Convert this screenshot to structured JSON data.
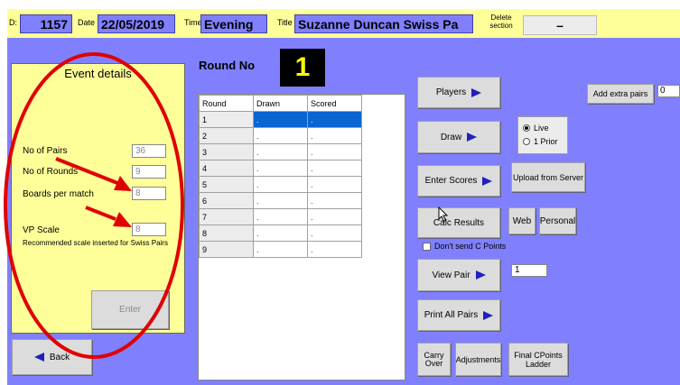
{
  "header": {
    "id_label": "D:",
    "id_value": "1157",
    "date_label": "Date",
    "date_value": "22/05/2019",
    "time_label": "Time",
    "time_value": "Evening",
    "title_label": "Title",
    "title_value": "Suzanne Duncan Swiss Pa",
    "delete_label_1": "Delete",
    "delete_label_2": "section",
    "delete_value": "–"
  },
  "event_details": {
    "heading": "Event details",
    "no_of_pairs_label": "No of Pairs",
    "no_of_pairs_value": "36",
    "no_of_rounds_label": "No of Rounds",
    "no_of_rounds_value": "9",
    "boards_per_match_label": "Boards per match",
    "boards_per_match_value": "8",
    "vp_scale_label": "VP Scale",
    "vp_scale_value": "8",
    "recommended_text": "Recommended scale inserted for Swiss Pairs",
    "enter_label": "Enter"
  },
  "round": {
    "label": "Round No",
    "value": "1"
  },
  "rounds_table": {
    "headers": [
      "Round",
      "Drawn",
      "Scored"
    ],
    "rows": [
      {
        "round": "1",
        "drawn": ".",
        "scored": "."
      },
      {
        "round": "2",
        "drawn": ".",
        "scored": "."
      },
      {
        "round": "3",
        "drawn": ".",
        "scored": "."
      },
      {
        "round": "4",
        "drawn": ".",
        "scored": "."
      },
      {
        "round": "5",
        "drawn": ".",
        "scored": "."
      },
      {
        "round": "6",
        "drawn": ".",
        "scored": "."
      },
      {
        "round": "7",
        "drawn": ".",
        "scored": "."
      },
      {
        "round": "8",
        "drawn": ".",
        "scored": "."
      },
      {
        "round": "9",
        "drawn": ".",
        "scored": "."
      }
    ],
    "selected_row": 0
  },
  "actions": {
    "players": "Players",
    "draw": "Draw",
    "enter_scores": "Enter Scores",
    "calc_results": "Calc Results",
    "web": "Web",
    "personal": "Personal",
    "dont_send_cpoints": "Don't send C Points",
    "view_pair": "View Pair",
    "view_pair_value": "1",
    "print_all_pairs": "Print All Pairs",
    "carry_over_1": "Carry",
    "carry_over_2": "Over",
    "adjustments": "Adjustments",
    "final_cpoints_1": "Final CPoints",
    "final_cpoints_2": "Ladder",
    "upload_from_server": "Upload from Server",
    "add_extra_pairs": "Add extra pairs",
    "add_extra_pairs_value": "0",
    "back": "Back"
  },
  "draw_mode": {
    "live": "Live",
    "prior": "1 Prior",
    "selected": "live"
  },
  "colors": {
    "background": "#8080ff",
    "header": "#ffff99",
    "panel": "#ffff99",
    "selection": "#0a64d2",
    "annotation": "#e00000",
    "arrow": "#2020c0"
  }
}
